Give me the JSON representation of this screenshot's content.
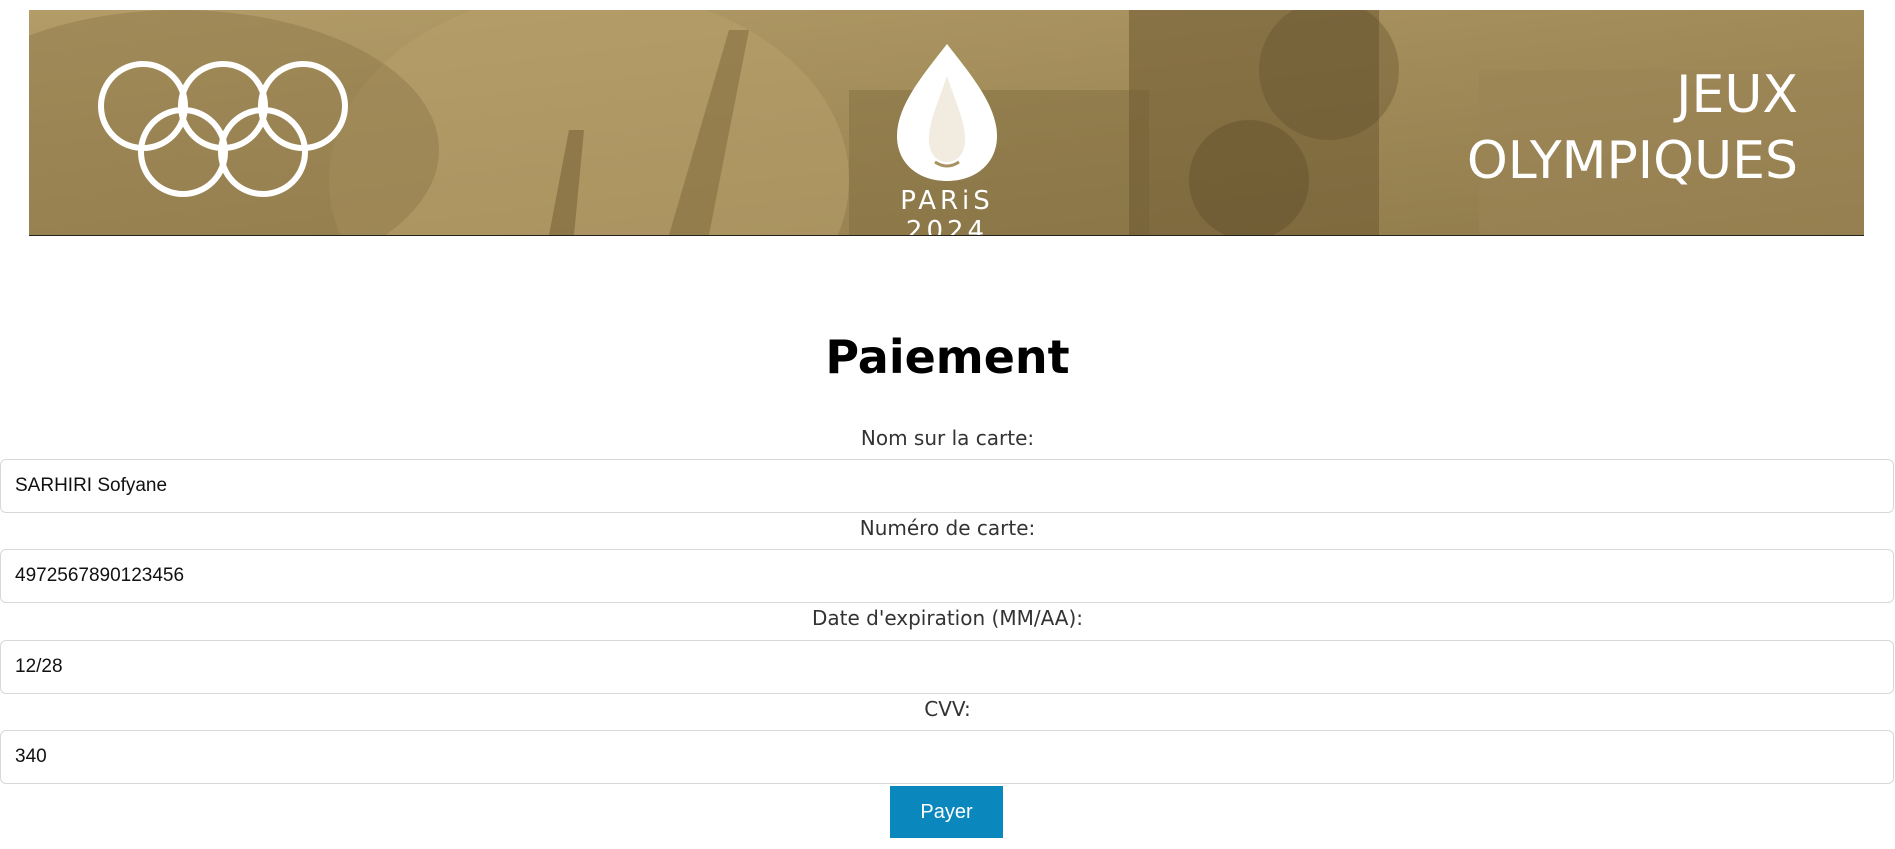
{
  "banner": {
    "paris_text": "PARiS 2024",
    "jeux_line1": "JEUX",
    "jeux_line2": "OLYMPIQUES",
    "background_color": "#a8915e"
  },
  "form": {
    "title": "Paiement",
    "name_label": "Nom sur la carte:",
    "name_value": "SARHIRI Sofyane",
    "card_label": "Numéro de carte:",
    "card_value": "4972567890123456",
    "expiry_label": "Date d'expiration (MM/AA):",
    "expiry_value": "12/28",
    "cvv_label": "CVV:",
    "cvv_value": "340",
    "submit_label": "Payer",
    "submit_color": "#0a87bd"
  }
}
